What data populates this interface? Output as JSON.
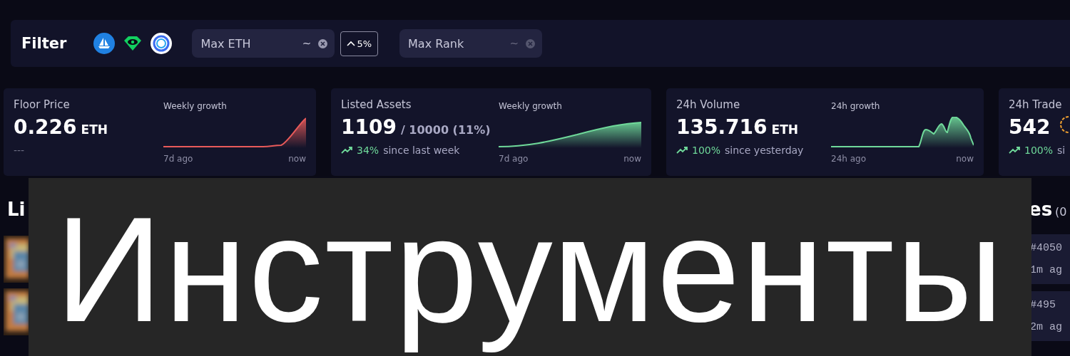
{
  "filter": {
    "title": "Filter",
    "sources": [
      {
        "kind": "boat"
      },
      {
        "kind": "gem"
      },
      {
        "kind": "ring"
      }
    ],
    "fields": [
      {
        "placeholder": "Max ETH",
        "separator": "~",
        "dim": false
      },
      {
        "placeholder": "Max Rank",
        "separator": "~",
        "dim": true
      }
    ],
    "step_button": "5%"
  },
  "stats": [
    {
      "title": "Floor Price",
      "value": "0.226",
      "unit": "ETH",
      "note": "---",
      "chart_label": "Weekly growth",
      "x_start": "7d ago",
      "x_end": "now",
      "kind": "spike",
      "color": "#e85a5a"
    },
    {
      "title": "Listed Assets",
      "value": "1109",
      "total": "/ 10000 (11%)",
      "change": "34%",
      "since": "since last week",
      "chart_label": "Weekly growth",
      "x_start": "7d ago",
      "x_end": "now",
      "kind": "rise",
      "color": "#6fd99a"
    },
    {
      "title": "24h Volume",
      "value": "135.716",
      "unit": "ETH",
      "change": "100%",
      "since": "since yesterday",
      "chart_label": "24h growth",
      "x_start": "24h ago",
      "x_end": "now",
      "kind": "peaks",
      "color": "#6fd99a"
    },
    {
      "title": "24h Trade",
      "value": "542",
      "gauge": true,
      "change": "100%",
      "since": "si"
    }
  ],
  "listings": {
    "heading": "Li"
  },
  "sales": {
    "heading": "es",
    "count": "(0",
    "rows": [
      {
        "id": "#4050",
        "time": "1m ag"
      },
      {
        "id": "#495",
        "time": "2m ag"
      }
    ]
  },
  "banner": {
    "title": "Инструменты"
  }
}
